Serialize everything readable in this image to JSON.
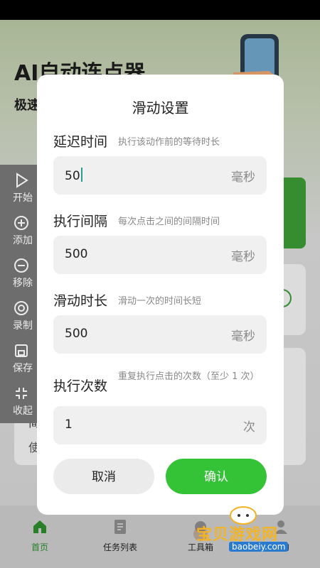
{
  "background": {
    "app_title": "AI自动连点器",
    "app_subtitle": "极速",
    "card_text_1": "简",
    "card_text_2": "使",
    "accent_color": "#3a9a35"
  },
  "float_panel": {
    "items": [
      {
        "label": "开始",
        "icon": "play-icon"
      },
      {
        "label": "添加",
        "icon": "plus-circle-icon"
      },
      {
        "label": "移除",
        "icon": "minus-circle-icon"
      },
      {
        "label": "录制",
        "icon": "record-icon"
      },
      {
        "label": "保存",
        "icon": "save-icon"
      },
      {
        "label": "收起",
        "icon": "collapse-icon"
      }
    ]
  },
  "bottom_nav": {
    "items": [
      {
        "label": "首页",
        "icon": "home-icon",
        "active": true
      },
      {
        "label": "任务列表",
        "icon": "list-icon",
        "active": false
      },
      {
        "label": "工具箱",
        "icon": "toolbox-icon",
        "active": false
      },
      {
        "label": "我的",
        "icon": "profile-icon",
        "active": false
      }
    ]
  },
  "dialog": {
    "title": "滑动设置",
    "fields": [
      {
        "label": "延迟时间",
        "hint": "执行该动作前的等待时长",
        "value": "50",
        "unit": "毫秒"
      },
      {
        "label": "执行间隔",
        "hint": "每次点击之间的间隔时间",
        "value": "500",
        "unit": "毫秒"
      },
      {
        "label": "滑动时长",
        "hint": "滑动一次的时间长短",
        "value": "500",
        "unit": "毫秒"
      },
      {
        "label": "执行次数",
        "hint": "重复执行点击的次数（至少 1 次）",
        "value": "1",
        "unit": "次"
      }
    ],
    "cancel_label": "取消",
    "confirm_label": "确认",
    "confirm_color": "#34c336"
  },
  "watermark": {
    "text": "宝贝游戏网",
    "url": "baobeiy.com"
  }
}
